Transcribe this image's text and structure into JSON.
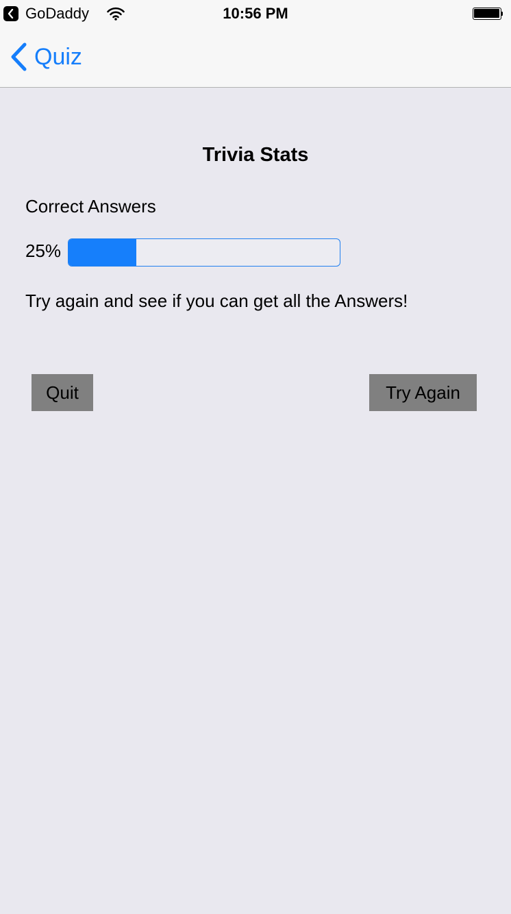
{
  "status_bar": {
    "back_app": "GoDaddy",
    "time": "10:56 PM",
    "icons": [
      "chevron-left-icon",
      "wifi-icon",
      "battery-icon"
    ]
  },
  "nav": {
    "back_label": "Quiz",
    "accent_color": "#157efb",
    "back_icon": "chevron-left-icon"
  },
  "main": {
    "title": "Trivia Stats",
    "section_label": "Correct Answers",
    "percent_text": "25%",
    "progress_fraction": 0.25,
    "progress_color": "#167ffb",
    "message": "Try again and see if you can get all the Answers!"
  },
  "buttons": {
    "quit_label": "Quit",
    "try_again_label": "Try Again"
  }
}
